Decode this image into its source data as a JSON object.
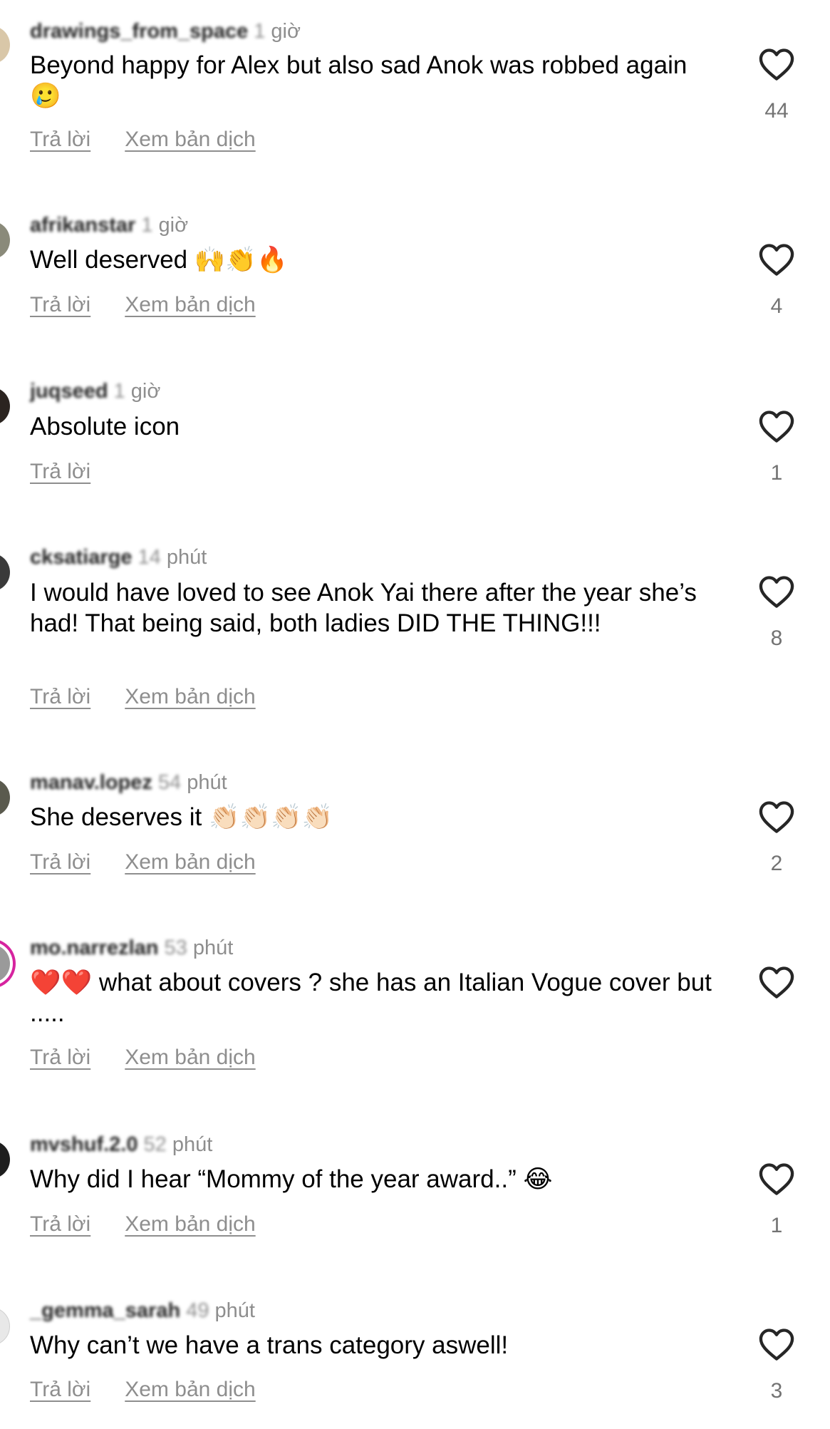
{
  "comments": [
    {
      "username": "drawings_from_space",
      "time_blur": "1",
      "time_unit": " giờ",
      "text": "Beyond happy for Alex but also sad Anok was robbed again 🥲",
      "reply": "Trả lời",
      "translate": "Xem bản dịch",
      "likes": "44"
    },
    {
      "username": "afrikanstar",
      "time_blur": "1",
      "time_unit": " giờ",
      "text": "Well deserved 🙌👏🔥",
      "reply": "Trả lời",
      "translate": "Xem bản dịch",
      "likes": "4"
    },
    {
      "username": "juqseed",
      "time_blur": "1",
      "time_unit": " giờ",
      "text": "Absolute icon",
      "reply": "Trả lời",
      "translate": "",
      "likes": "1"
    },
    {
      "username": "cksatiarge",
      "time_blur": "14",
      "time_unit": " phút",
      "text": "I would have loved to see Anok Yai there after the year she’s had! That being said, both ladies DID THE THING!!!",
      "reply": "Trả lời",
      "translate": "Xem bản dịch",
      "likes": "8"
    },
    {
      "username": "manav.lopez",
      "time_blur": "54",
      "time_unit": " phút",
      "text": "She deserves it 👏🏻👏🏻👏🏻👏🏻",
      "reply": "Trả lời",
      "translate": "Xem bản dịch",
      "likes": "2"
    },
    {
      "username": "mo.narrezlan",
      "time_blur": "53",
      "time_unit": " phút",
      "text": "❤️❤️ what about covers ? she has an Italian  Vogue cover but .....",
      "reply": "Trả lời",
      "translate": "Xem bản dịch",
      "likes": ""
    },
    {
      "username": "mvshuf.2.0",
      "time_blur": "52",
      "time_unit": " phút",
      "text": "Why did I hear “Mommy of the year award..” 😂",
      "reply": "Trả lời",
      "translate": "Xem bản dịch",
      "likes": "1"
    },
    {
      "username": "_gemma_sarah",
      "time_blur": "49",
      "time_unit": " phút",
      "text": "Why can’t we have a trans category aswell!",
      "reply": "Trả lời",
      "translate": "Xem bản dịch",
      "likes": "3"
    }
  ],
  "colors": {
    "secondary_text": "#8e8e8e",
    "like_count": "#737373",
    "story_ring": "#d6249f"
  },
  "icons": {
    "like": "heart-outline-icon"
  }
}
